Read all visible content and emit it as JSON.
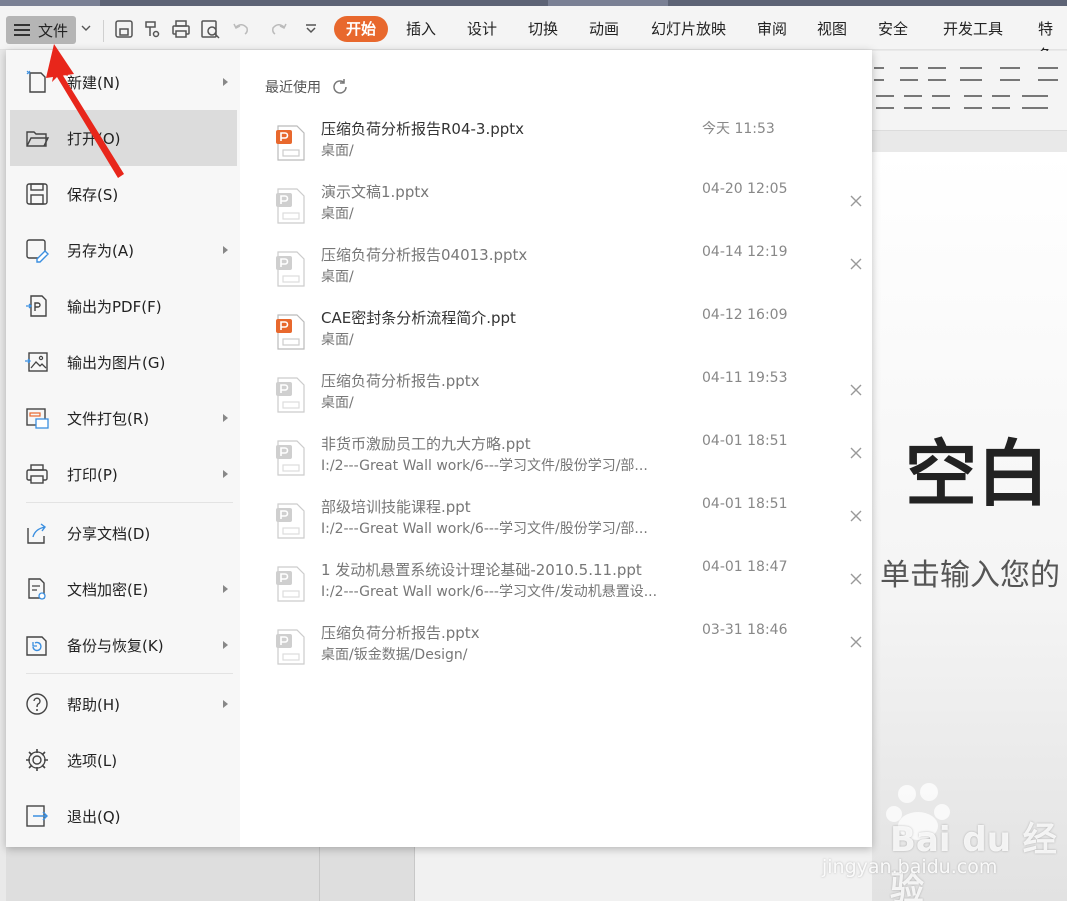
{
  "toolbar": {
    "file_label": "文件",
    "tabs": [
      {
        "label": "开始",
        "active": true
      },
      {
        "label": "插入"
      },
      {
        "label": "设计"
      },
      {
        "label": "切换"
      },
      {
        "label": "动画"
      },
      {
        "label": "幻灯片放映"
      },
      {
        "label": "审阅"
      },
      {
        "label": "视图"
      },
      {
        "label": "安全"
      },
      {
        "label": "开发工具"
      },
      {
        "label": "特色"
      }
    ],
    "accent_color": "#e8682d"
  },
  "menu": {
    "items": [
      {
        "label": "新建(N)",
        "icon": "new-file-icon"
      },
      {
        "label": "打开(O)",
        "icon": "folder-open-icon"
      },
      {
        "label": "保存(S)",
        "icon": "save-icon"
      },
      {
        "label": "另存为(A)",
        "icon": "save-as-icon"
      },
      {
        "label": "输出为PDF(F)",
        "icon": "export-pdf-icon"
      },
      {
        "label": "输出为图片(G)",
        "icon": "export-image-icon"
      },
      {
        "label": "文件打包(R)",
        "icon": "package-icon"
      },
      {
        "label": "打印(P)",
        "icon": "print-icon"
      },
      {
        "label": "分享文档(D)",
        "icon": "share-icon"
      },
      {
        "label": "文档加密(E)",
        "icon": "encrypt-icon"
      },
      {
        "label": "备份与恢复(K)",
        "icon": "backup-icon"
      },
      {
        "label": "帮助(H)",
        "icon": "help-icon"
      },
      {
        "label": "选项(L)",
        "icon": "settings-icon"
      },
      {
        "label": "退出(Q)",
        "icon": "exit-icon"
      }
    ]
  },
  "recent": {
    "heading": "最近使用",
    "files": [
      {
        "name": "压缩负荷分析报告R04-3.pptx",
        "path": "桌面/",
        "time": "今天 11:53"
      },
      {
        "name": "演示文稿1.pptx",
        "path": "桌面/",
        "time": "04-20 12:05"
      },
      {
        "name": "压缩负荷分析报告04013.pptx",
        "path": "桌面/",
        "time": "04-14 12:19"
      },
      {
        "name": "CAE密封条分析流程简介.ppt",
        "path": "桌面/",
        "time": "04-12 16:09"
      },
      {
        "name": "压缩负荷分析报告.pptx",
        "path": "桌面/",
        "time": "04-11 19:53"
      },
      {
        "name": "非货币激励员工的九大方略.ppt",
        "path": "I:/2---Great Wall work/6---学习文件/股份学习/部...",
        "time": "04-01 18:51"
      },
      {
        "name": "部级培训技能课程.ppt",
        "path": "I:/2---Great Wall work/6---学习文件/股份学习/部...",
        "time": "04-01 18:51"
      },
      {
        "name": "1 发动机悬置系统设计理论基础-2010.5.11.ppt",
        "path": "I:/2---Great Wall work/6---学习文件/发动机悬置设...",
        "time": "04-01 18:47"
      },
      {
        "name": "压缩负荷分析报告.pptx",
        "path": "桌面/钣金数据/Design/",
        "time": "03-31 18:46"
      }
    ]
  },
  "slide": {
    "title": "空白",
    "subtitle": "单击输入您的"
  },
  "watermark": {
    "brand": "Bai du 经验",
    "url": "jingyan.baidu.com"
  }
}
